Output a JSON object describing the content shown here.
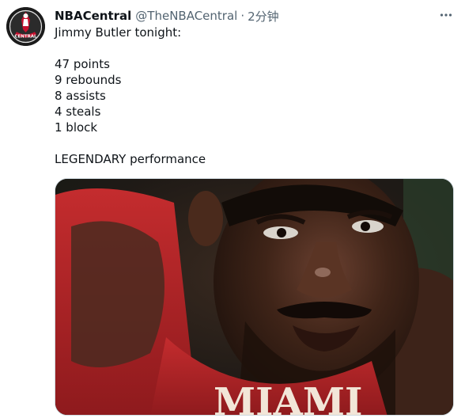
{
  "tweet": {
    "display_name": "NBACentral",
    "handle": "@TheNBACentral",
    "separator": "·",
    "time": "2分钟",
    "lines": [
      "Jimmy Butler tonight:",
      "",
      "47 points",
      "9 rebounds",
      "8 assists",
      "4 steals",
      "1 block",
      "",
      "LEGENDARY performance"
    ],
    "more_icon": "more-horizontal-icon",
    "avatar_logo_text": "CENTRAL",
    "jersey_text": "MIAMI"
  },
  "colors": {
    "name_text": "#0f1419",
    "secondary_text": "#536471",
    "avatar_bg": "#1a1a1a",
    "avatar_red": "#c8102e",
    "jersey_red": "#b5212a"
  }
}
